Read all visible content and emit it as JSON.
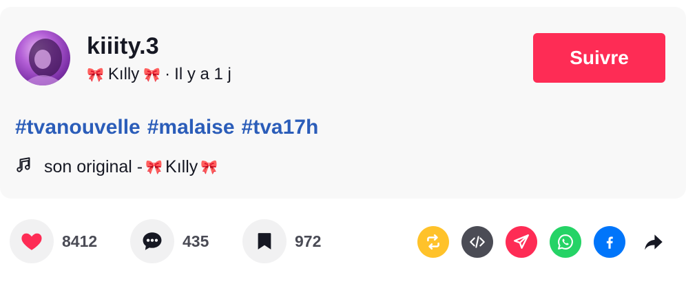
{
  "post": {
    "username": "kiiity.3",
    "display_name": "Kılly",
    "separator": "·",
    "time_ago": "Il y a 1 j",
    "follow_label": "Suivre",
    "hashtags": [
      "#tvanouvelle",
      "#malaise",
      "#tva17h"
    ],
    "sound_prefix": "son original -",
    "sound_artist": "Kılly"
  },
  "actions": {
    "likes": "8412",
    "comments": "435",
    "saves": "972"
  },
  "colors": {
    "follow": "#fe2c55",
    "hashtag": "#2b5db9",
    "like": "#fe2c55",
    "repost": "#ffc22a",
    "embed": "#4b4c55",
    "send": "#fe2c55",
    "whatsapp": "#25d366",
    "facebook": "#0075fa"
  },
  "icons": [
    "heart-icon",
    "comment-icon",
    "bookmark-icon",
    "repost-icon",
    "embed-icon",
    "send-icon",
    "whatsapp-icon",
    "facebook-icon",
    "share-arrow-icon",
    "music-note-icon",
    "bow-icon"
  ]
}
